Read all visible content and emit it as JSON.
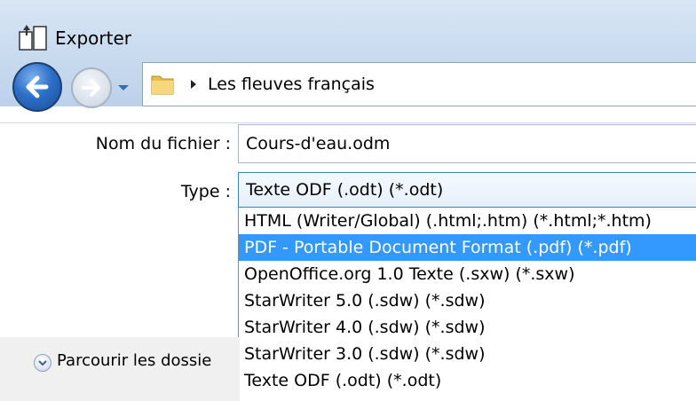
{
  "window": {
    "title": "Exporter"
  },
  "navigation": {
    "back_icon": "back-arrow-icon",
    "forward_icon": "forward-arrow-icon",
    "history_dropdown_icon": "chevron-down-icon",
    "breadcrumb": {
      "folder_icon": "folder-icon",
      "separator_icon": "triangle-right-icon",
      "location": "Les fleuves français"
    }
  },
  "form": {
    "filename_label": "Nom du fichier :",
    "filename_value": "Cours-d'eau.odm",
    "type_label": "Type :",
    "type_value": "Texte ODF (.odt) (*.odt)"
  },
  "type_options": [
    {
      "label": "HTML (Writer/Global) (.html;.htm) (*.html;*.htm)",
      "selected": false
    },
    {
      "label": "PDF - Portable Document Format (.pdf) (*.pdf)",
      "selected": true
    },
    {
      "label": "OpenOffice.org 1.0 Texte (.sxw) (*.sxw)",
      "selected": false
    },
    {
      "label": "StarWriter 5.0 (.sdw) (*.sdw)",
      "selected": false
    },
    {
      "label": "StarWriter 4.0 (.sdw) (*.sdw)",
      "selected": false
    },
    {
      "label": "StarWriter 3.0 (.sdw) (*.sdw)",
      "selected": false
    },
    {
      "label": "Texte ODF (.odt) (*.odt)",
      "selected": false
    }
  ],
  "browse": {
    "label": "Parcourir les dossie",
    "icon": "chevron-down-circle-icon"
  },
  "colors": {
    "selection": "#3399ff",
    "titlebar": "#c9dbef"
  }
}
